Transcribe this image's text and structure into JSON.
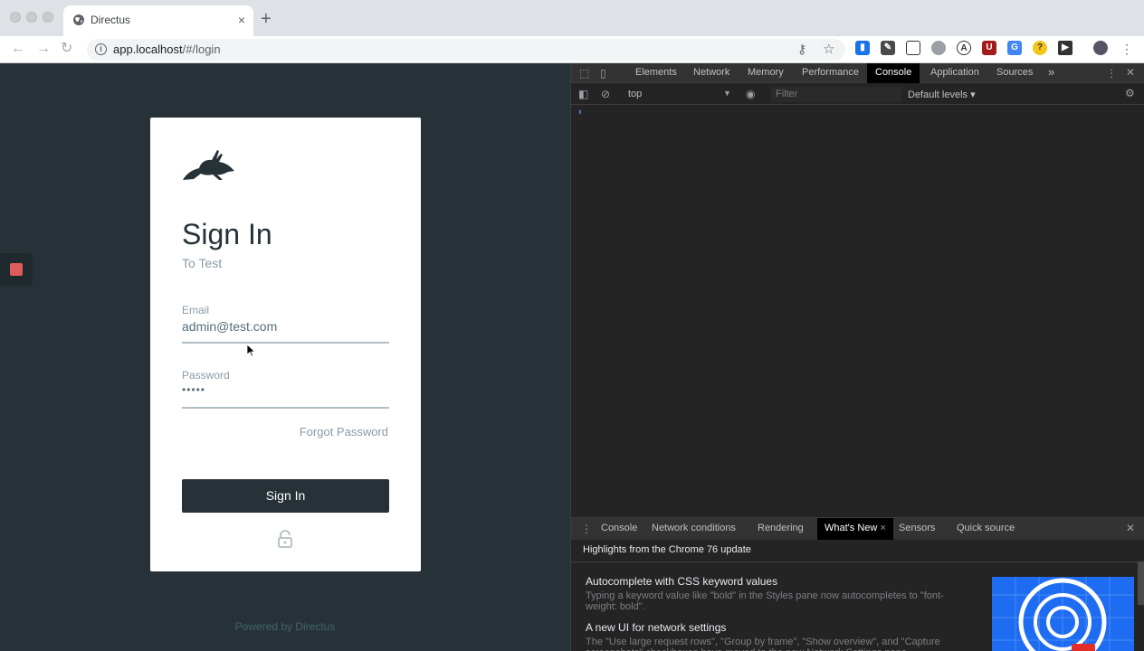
{
  "browser": {
    "tab_title": "Directus",
    "tab_close": "×",
    "new_tab": "+",
    "url_host": "app.localhost",
    "url_path": "/#/login"
  },
  "login": {
    "title": "Sign In",
    "subtitle": "To Test",
    "email_label": "Email",
    "email_value": "admin@test.com",
    "password_label": "Password",
    "password_value": "•••••",
    "forgot": "Forgot Password",
    "submit": "Sign In",
    "powered_by": "Powered by Directus"
  },
  "devtools": {
    "tabs": [
      "Elements",
      "Network",
      "Memory",
      "Performance",
      "Console",
      "Application",
      "Sources"
    ],
    "active_tab": "Console",
    "more": "»",
    "context": "top",
    "filter_placeholder": "Filter",
    "levels": "Default levels ▾",
    "prompt": "›",
    "drawer_tabs": [
      "Console",
      "Network conditions",
      "Rendering",
      "What's New",
      "Sensors",
      "Quick source"
    ],
    "drawer_active": "What's New",
    "drawer_heading": "Highlights from the Chrome 76 update",
    "items": [
      {
        "title": "Autocomplete with CSS keyword values",
        "desc": "Typing a keyword value like \"bold\" in the Styles pane now autocompletes to \"font-weight: bold\"."
      },
      {
        "title": "A new UI for network settings",
        "desc": "The \"Use large request rows\", \"Group by frame\", \"Show overview\", and \"Capture screenshots\" checkboxes have moved to the new Network Settings pane."
      }
    ]
  },
  "colors": {
    "page_bg": "#263238",
    "card_bg": "#ffffff",
    "button_bg": "#263238",
    "devtools_bg": "#242424"
  }
}
